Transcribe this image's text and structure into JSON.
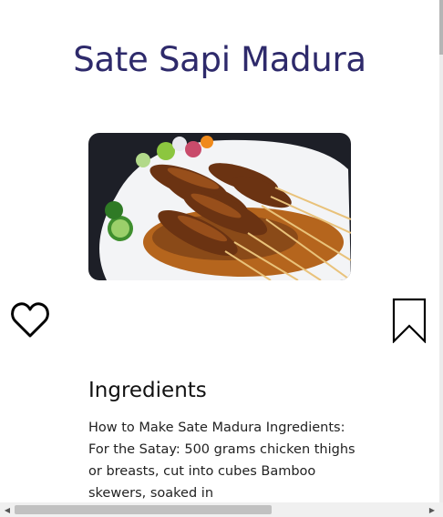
{
  "recipe": {
    "title": "Sate Sapi Madura",
    "image_alt": "Sate Sapi Madura",
    "ingredients_heading": "Ingredients",
    "ingredients_text": "How to Make Sate Madura Ingredients: For the Satay: 500 grams chicken thighs or breasts, cut into cubes Bamboo skewers, soaked in"
  },
  "icons": {
    "favorite": "heart-outline-icon",
    "bookmark": "bookmark-outline-icon"
  },
  "colors": {
    "title": "#2e2a6b",
    "text": "#222222"
  }
}
